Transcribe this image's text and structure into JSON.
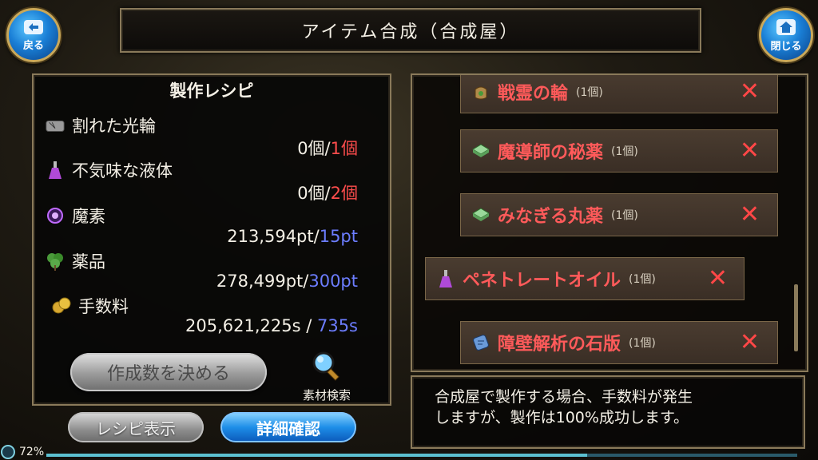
{
  "header": {
    "title": "アイテム合成（合成屋）"
  },
  "nav": {
    "back_label": "戻る",
    "close_label": "閉じる"
  },
  "recipe": {
    "title": "製作レシピ",
    "ingredients": [
      {
        "name": "割れた光輪",
        "have": "0個/",
        "need": "1個",
        "need_color": "red",
        "icon": "broken-halo-icon"
      },
      {
        "name": "不気味な液体",
        "have": "0個/",
        "need": "2個",
        "need_color": "red",
        "icon": "potion-flask-icon"
      },
      {
        "name": "魔素",
        "have": "213,594pt/",
        "need": "15pt",
        "need_color": "blue",
        "icon": "mana-orb-icon"
      },
      {
        "name": "薬品",
        "have": "278,499pt/",
        "need": "300pt",
        "need_color": "blue",
        "icon": "herb-icon"
      },
      {
        "name": "手数料",
        "have": "205,621,225s / ",
        "need": "735s",
        "need_color": "blue",
        "icon": "coins-icon"
      }
    ],
    "decide_button": "作成数を決める",
    "search_label": "素材検索"
  },
  "bottom_buttons": {
    "recipe_display": "レシピ表示",
    "detail_confirm": "詳細確認"
  },
  "materials": [
    {
      "name": "戦霊の輪",
      "qty": "(1個)",
      "icon": "pouch-icon"
    },
    {
      "name": "魔導師の秘薬",
      "qty": "(1個)",
      "icon": "medicine-box-icon"
    },
    {
      "name": "みなぎる丸薬",
      "qty": "(1個)",
      "icon": "medicine-box-icon"
    },
    {
      "name": "ペネトレートオイル",
      "qty": "(1個)",
      "icon": "potion-flask-icon"
    },
    {
      "name": "障壁解析の石版",
      "qty": "(1個)",
      "icon": "stone-tablet-icon"
    }
  ],
  "message": {
    "line1": "合成屋で製作する場合、手数料が発生",
    "line2": "しますが、製作は100%成功します。"
  },
  "status": {
    "battery": "72%",
    "battery_level": 0.72
  },
  "colors": {
    "need_red": "#ff4d4d",
    "need_blue": "#6c7dff",
    "material_red": "#ff5a5a",
    "frame_gold": "#8a7a5a"
  }
}
